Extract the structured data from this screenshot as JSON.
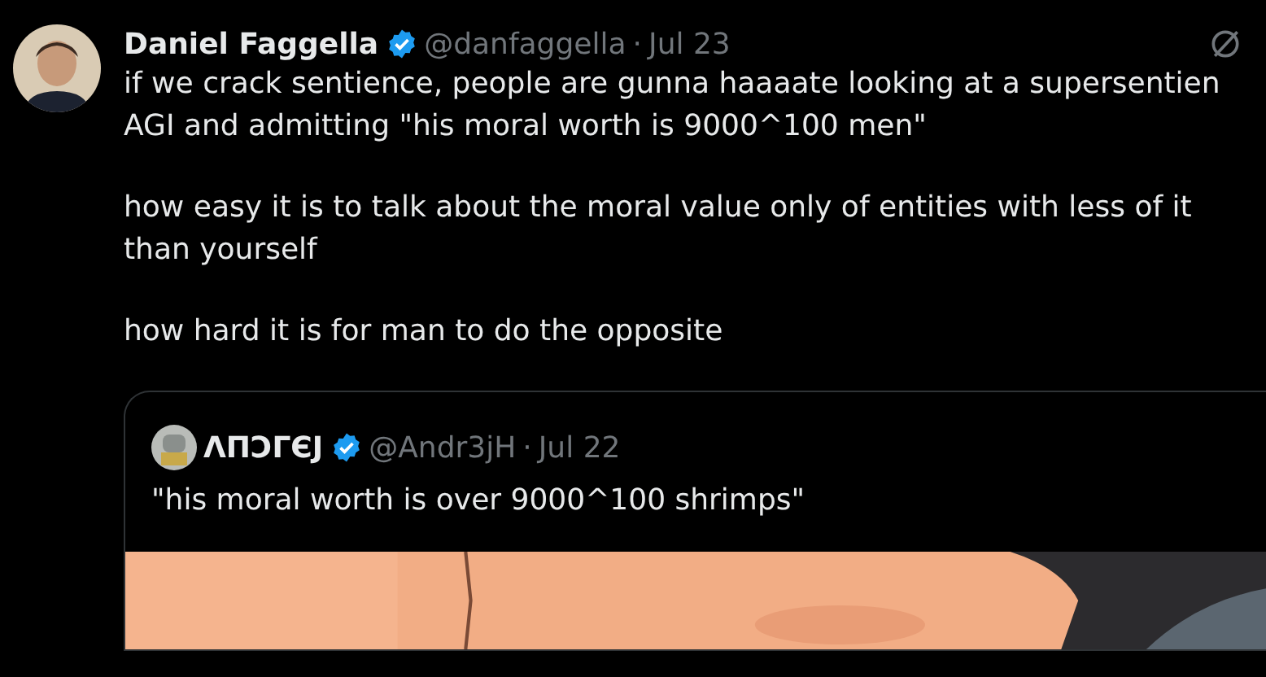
{
  "tweet": {
    "name": "Daniel Faggella",
    "verified": true,
    "handle": "@danfaggella",
    "separator": "·",
    "date": "Jul 23",
    "paragraphs": [
      "if we crack sentience, people are gunna haaaate looking at a supersentien\nAGI and admitting \"his moral worth is 9000^100 men\"",
      "how easy it is to talk about the moral value only of entities with less of it\nthan yourself",
      "how hard it is for man to do the opposite"
    ],
    "quote": {
      "name": "ΛПƆΓЄJ",
      "verified": true,
      "handle": "@Andr3jH",
      "separator": "·",
      "date": "Jul 22",
      "text": "\"his moral worth is over 9000^100 shrimps\""
    }
  }
}
